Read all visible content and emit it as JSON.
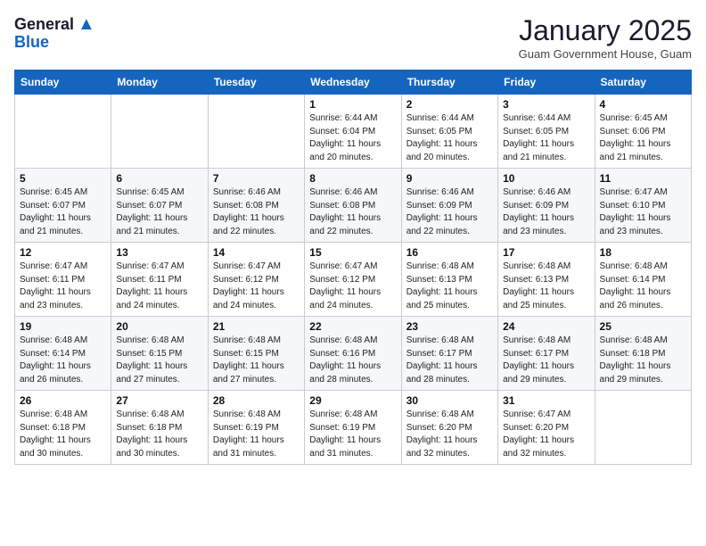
{
  "header": {
    "logo_general": "General",
    "logo_blue": "Blue",
    "month_title": "January 2025",
    "subtitle": "Guam Government House, Guam"
  },
  "weekdays": [
    "Sunday",
    "Monday",
    "Tuesday",
    "Wednesday",
    "Thursday",
    "Friday",
    "Saturday"
  ],
  "weeks": [
    [
      {
        "day": "",
        "info": ""
      },
      {
        "day": "",
        "info": ""
      },
      {
        "day": "",
        "info": ""
      },
      {
        "day": "1",
        "info": "Sunrise: 6:44 AM\nSunset: 6:04 PM\nDaylight: 11 hours\nand 20 minutes."
      },
      {
        "day": "2",
        "info": "Sunrise: 6:44 AM\nSunset: 6:05 PM\nDaylight: 11 hours\nand 20 minutes."
      },
      {
        "day": "3",
        "info": "Sunrise: 6:44 AM\nSunset: 6:05 PM\nDaylight: 11 hours\nand 21 minutes."
      },
      {
        "day": "4",
        "info": "Sunrise: 6:45 AM\nSunset: 6:06 PM\nDaylight: 11 hours\nand 21 minutes."
      }
    ],
    [
      {
        "day": "5",
        "info": "Sunrise: 6:45 AM\nSunset: 6:07 PM\nDaylight: 11 hours\nand 21 minutes."
      },
      {
        "day": "6",
        "info": "Sunrise: 6:45 AM\nSunset: 6:07 PM\nDaylight: 11 hours\nand 21 minutes."
      },
      {
        "day": "7",
        "info": "Sunrise: 6:46 AM\nSunset: 6:08 PM\nDaylight: 11 hours\nand 22 minutes."
      },
      {
        "day": "8",
        "info": "Sunrise: 6:46 AM\nSunset: 6:08 PM\nDaylight: 11 hours\nand 22 minutes."
      },
      {
        "day": "9",
        "info": "Sunrise: 6:46 AM\nSunset: 6:09 PM\nDaylight: 11 hours\nand 22 minutes."
      },
      {
        "day": "10",
        "info": "Sunrise: 6:46 AM\nSunset: 6:09 PM\nDaylight: 11 hours\nand 23 minutes."
      },
      {
        "day": "11",
        "info": "Sunrise: 6:47 AM\nSunset: 6:10 PM\nDaylight: 11 hours\nand 23 minutes."
      }
    ],
    [
      {
        "day": "12",
        "info": "Sunrise: 6:47 AM\nSunset: 6:11 PM\nDaylight: 11 hours\nand 23 minutes."
      },
      {
        "day": "13",
        "info": "Sunrise: 6:47 AM\nSunset: 6:11 PM\nDaylight: 11 hours\nand 24 minutes."
      },
      {
        "day": "14",
        "info": "Sunrise: 6:47 AM\nSunset: 6:12 PM\nDaylight: 11 hours\nand 24 minutes."
      },
      {
        "day": "15",
        "info": "Sunrise: 6:47 AM\nSunset: 6:12 PM\nDaylight: 11 hours\nand 24 minutes."
      },
      {
        "day": "16",
        "info": "Sunrise: 6:48 AM\nSunset: 6:13 PM\nDaylight: 11 hours\nand 25 minutes."
      },
      {
        "day": "17",
        "info": "Sunrise: 6:48 AM\nSunset: 6:13 PM\nDaylight: 11 hours\nand 25 minutes."
      },
      {
        "day": "18",
        "info": "Sunrise: 6:48 AM\nSunset: 6:14 PM\nDaylight: 11 hours\nand 26 minutes."
      }
    ],
    [
      {
        "day": "19",
        "info": "Sunrise: 6:48 AM\nSunset: 6:14 PM\nDaylight: 11 hours\nand 26 minutes."
      },
      {
        "day": "20",
        "info": "Sunrise: 6:48 AM\nSunset: 6:15 PM\nDaylight: 11 hours\nand 27 minutes."
      },
      {
        "day": "21",
        "info": "Sunrise: 6:48 AM\nSunset: 6:15 PM\nDaylight: 11 hours\nand 27 minutes."
      },
      {
        "day": "22",
        "info": "Sunrise: 6:48 AM\nSunset: 6:16 PM\nDaylight: 11 hours\nand 28 minutes."
      },
      {
        "day": "23",
        "info": "Sunrise: 6:48 AM\nSunset: 6:17 PM\nDaylight: 11 hours\nand 28 minutes."
      },
      {
        "day": "24",
        "info": "Sunrise: 6:48 AM\nSunset: 6:17 PM\nDaylight: 11 hours\nand 29 minutes."
      },
      {
        "day": "25",
        "info": "Sunrise: 6:48 AM\nSunset: 6:18 PM\nDaylight: 11 hours\nand 29 minutes."
      }
    ],
    [
      {
        "day": "26",
        "info": "Sunrise: 6:48 AM\nSunset: 6:18 PM\nDaylight: 11 hours\nand 30 minutes."
      },
      {
        "day": "27",
        "info": "Sunrise: 6:48 AM\nSunset: 6:18 PM\nDaylight: 11 hours\nand 30 minutes."
      },
      {
        "day": "28",
        "info": "Sunrise: 6:48 AM\nSunset: 6:19 PM\nDaylight: 11 hours\nand 31 minutes."
      },
      {
        "day": "29",
        "info": "Sunrise: 6:48 AM\nSunset: 6:19 PM\nDaylight: 11 hours\nand 31 minutes."
      },
      {
        "day": "30",
        "info": "Sunrise: 6:48 AM\nSunset: 6:20 PM\nDaylight: 11 hours\nand 32 minutes."
      },
      {
        "day": "31",
        "info": "Sunrise: 6:47 AM\nSunset: 6:20 PM\nDaylight: 11 hours\nand 32 minutes."
      },
      {
        "day": "",
        "info": ""
      }
    ]
  ]
}
